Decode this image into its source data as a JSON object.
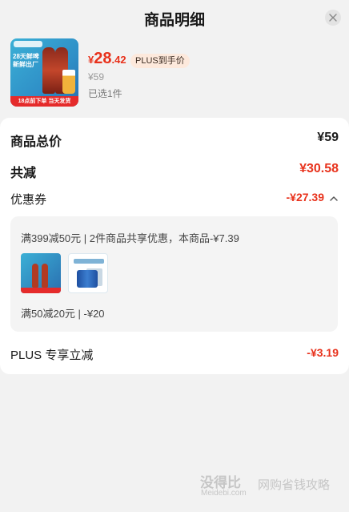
{
  "header": {
    "title": "商品明细",
    "close_icon": "close-icon"
  },
  "product": {
    "image_alt": "28天鲜啤 精酿啤酒",
    "image_text": "28天鲜啤 新鲜出厂",
    "image_strip": "18点前下单 当天发货",
    "price_currency": "¥",
    "price_int": "28",
    "price_dec": ".42",
    "plus_badge": "PLUS到手价",
    "original_price": "¥59",
    "selected_count": "已选1件"
  },
  "summary": {
    "total_label": "商品总价",
    "total_value": "¥59",
    "discount_label": "共减",
    "discount_value": "¥30.58",
    "coupon_label": "优惠券",
    "coupon_value": "-¥27.39",
    "coupon_rule_1": "满399减50元 | 2件商品共享优惠，本商品-¥7.39",
    "coupon_rule_2": "满50减20元 | -¥20",
    "plus_label": "PLUS 专享立减",
    "plus_value": "-¥3.19"
  },
  "watermark": {
    "brand": "没得比",
    "domain": "Meidebi.com",
    "slogan": "网购省钱攻略"
  },
  "colors": {
    "accent_red": "#e8321c",
    "card_bg": "#ffffff",
    "page_bg": "#f2f2f2",
    "badge_bg": "#fde9dc"
  }
}
